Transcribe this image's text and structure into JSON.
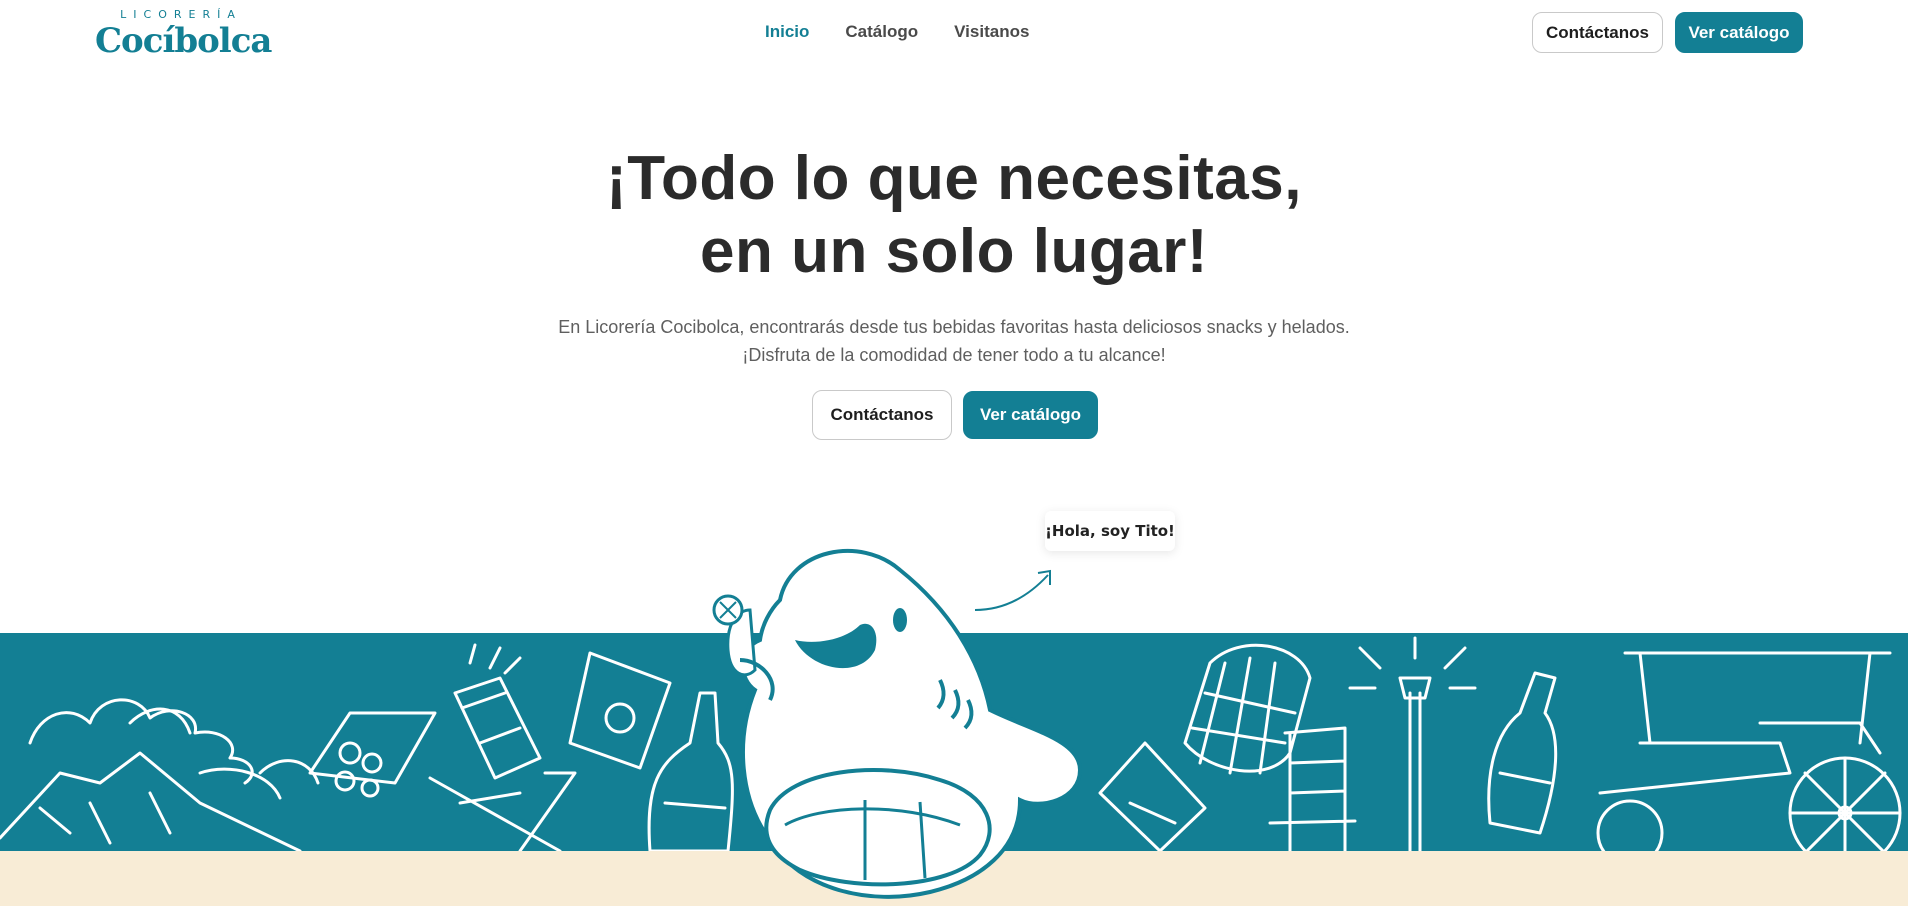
{
  "brand": {
    "name_top": "LICORERÍA",
    "name_main": "Cocíbolca"
  },
  "nav": {
    "items": [
      {
        "label": "Inicio",
        "active": true
      },
      {
        "label": "Catálogo",
        "active": false
      },
      {
        "label": "Visitanos",
        "active": false
      }
    ]
  },
  "header": {
    "contact_label": "Contáctanos",
    "catalog_label": "Ver catálogo"
  },
  "hero": {
    "title_line1": "¡Todo lo que necesitas,",
    "title_line2": "en un solo lugar!",
    "subtitle_line1": "En Licorería Cocibolca, encontrarás desde tus bebidas favoritas hasta deliciosos snacks y helados.",
    "subtitle_line2": "¡Disfruta de la comodidad de tener todo a tu alcance!",
    "contact_label": "Contáctanos",
    "catalog_label": "Ver catálogo"
  },
  "mascot": {
    "greeting": "¡Hola, soy Tito!"
  },
  "colors": {
    "accent": "#137f94",
    "text_dark": "#2b2b2b",
    "text_muted": "#5f5f5f",
    "cream": "#f8ecd6",
    "white": "#ffffff"
  },
  "illustrations": [
    "volcano-icon",
    "chips-bag-icon",
    "beer-can-icon",
    "chips-bag-icon",
    "beach-chair-icon",
    "bottle-icon",
    "barrel-icon",
    "snack-bag-icon",
    "wooden-chair-icon",
    "street-lamp-icon",
    "soda-bottle-icon",
    "horse-carriage-icon",
    "shark-mascot-icon"
  ]
}
